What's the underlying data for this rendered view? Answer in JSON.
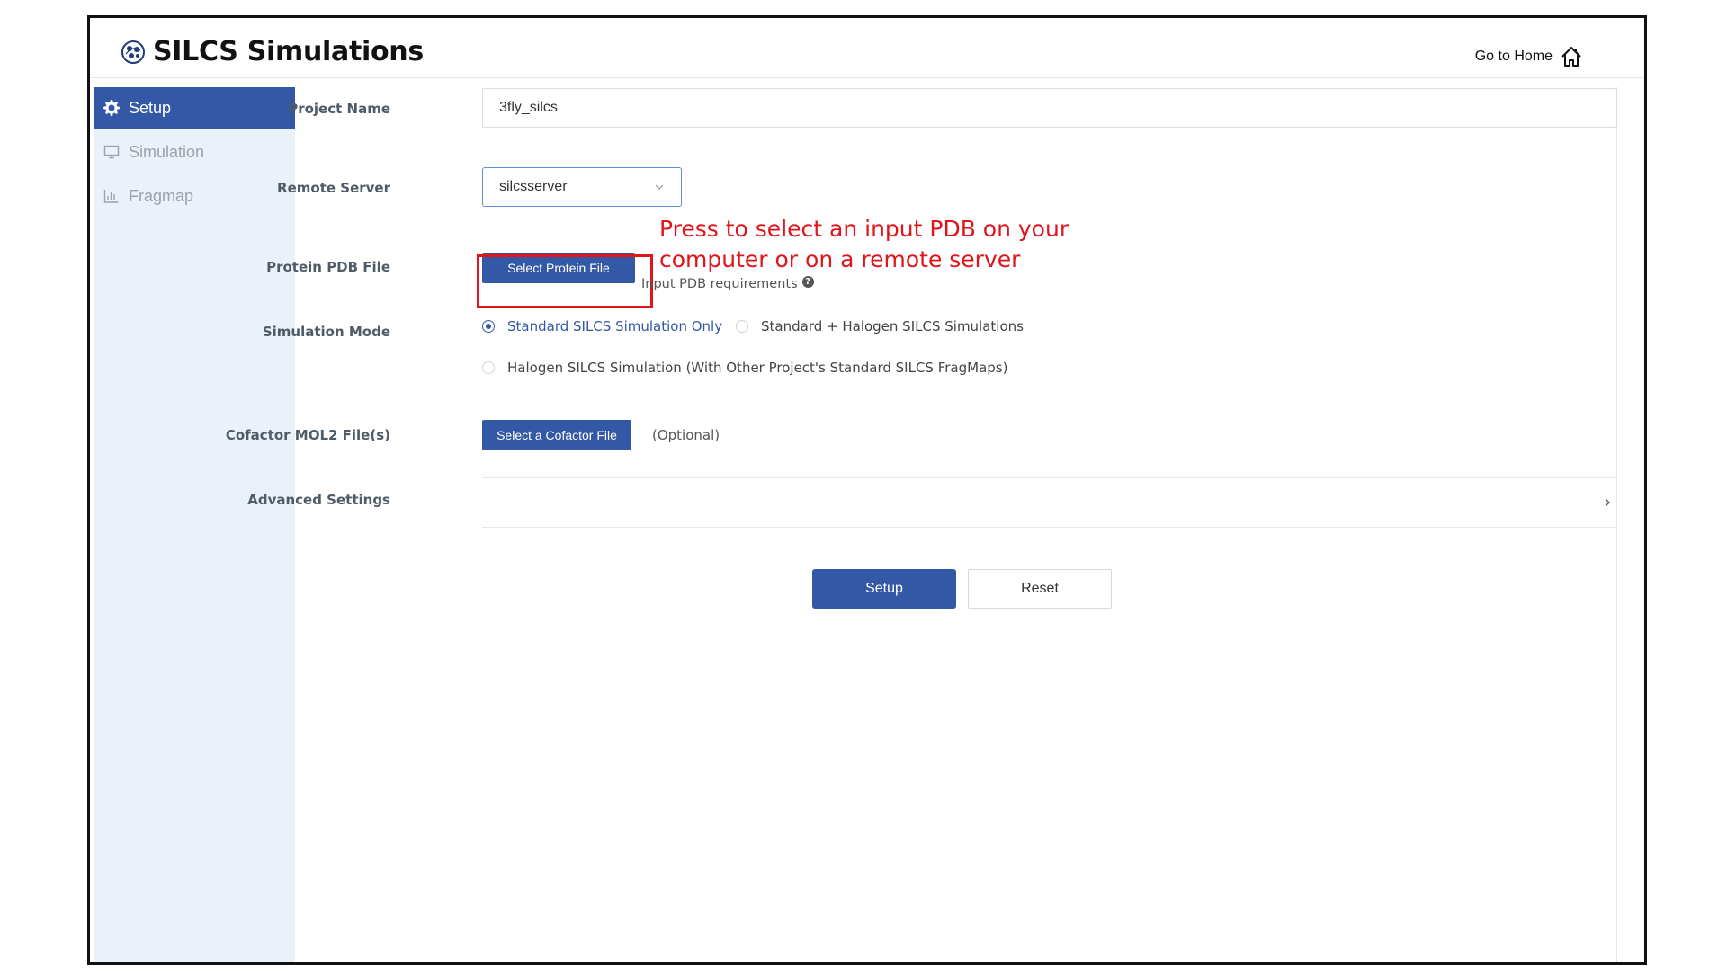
{
  "header": {
    "app_title": "SILCS Simulations",
    "home_link": "Go to Home",
    "logo_icon": "silcs-logo-icon",
    "home_icon": "home-icon"
  },
  "sidebar": {
    "items": [
      {
        "label": "Setup",
        "icon": "gear-icon",
        "active": true
      },
      {
        "label": "Simulation",
        "icon": "monitor-icon",
        "active": false
      },
      {
        "label": "Fragmap",
        "icon": "bar-chart-icon",
        "active": false
      }
    ]
  },
  "form": {
    "project_name": {
      "label": "Project Name",
      "value": "3fly_silcs"
    },
    "remote_server": {
      "label": "Remote Server",
      "value": "silcsserver"
    },
    "protein_pdb": {
      "label": "Protein PDB File",
      "button": "Select Protein File",
      "requirements": "Input PDB requirements"
    },
    "simulation_mode": {
      "label": "Simulation Mode",
      "options": [
        {
          "label": "Standard SILCS Simulation Only",
          "checked": true
        },
        {
          "label": "Standard + Halogen SILCS Simulations",
          "checked": false
        },
        {
          "label": "Halogen SILCS Simulation (With Other Project's Standard SILCS FragMaps)",
          "checked": false
        }
      ]
    },
    "cofactor": {
      "label": "Cofactor MOL2 File(s)",
      "button": "Select a Cofactor File",
      "note": "(Optional)"
    },
    "advanced": {
      "label": "Advanced Settings"
    }
  },
  "actions": {
    "setup": "Setup",
    "reset": "Reset"
  },
  "annotation": {
    "line1": "Press to select an input PDB on your",
    "line2": "computer or on a remote server"
  },
  "colors": {
    "primary": "#3358a6",
    "annotation": "#e0141b",
    "sidebar_bg": "#eaf1f8"
  }
}
